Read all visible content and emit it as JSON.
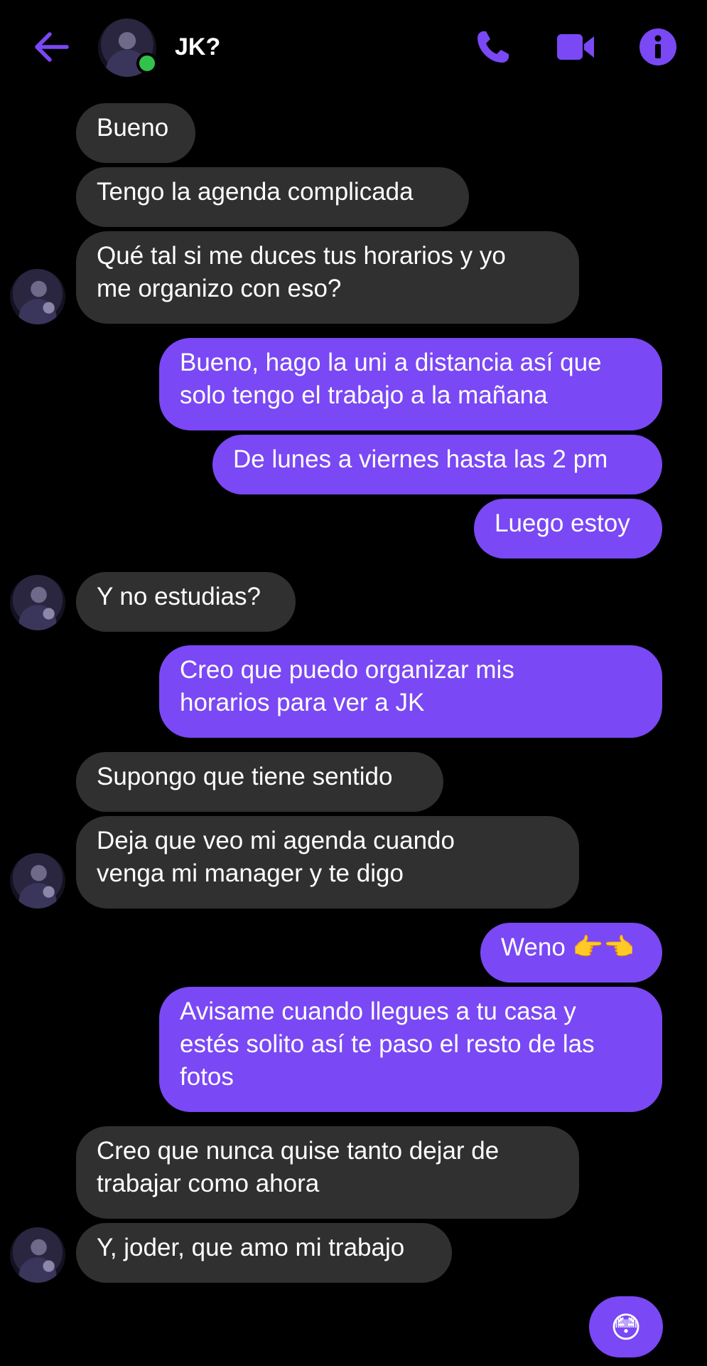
{
  "header": {
    "contact_name": "JK?",
    "status": "online",
    "icons": {
      "back": "back-arrow-icon",
      "call": "phone-icon",
      "video": "video-camera-icon",
      "info": "info-icon"
    },
    "accent_color": "#7a48f4",
    "online_color": "#31c24b"
  },
  "messages": [
    {
      "side": "received",
      "text": "Bueno"
    },
    {
      "side": "received",
      "text": "Tengo la agenda complicada"
    },
    {
      "side": "received",
      "line1": "Qué tal si me duces tus horarios y yo",
      "line2": "me organizo con eso?"
    },
    {
      "side": "sent",
      "line1": "Bueno, hago la uni a distancia así que",
      "line2": "solo tengo el trabajo a la mañana"
    },
    {
      "side": "sent",
      "text": "De lunes a viernes hasta las 2 pm"
    },
    {
      "side": "sent",
      "text": "Luego estoy"
    },
    {
      "side": "received",
      "text": "Y no estudias?"
    },
    {
      "side": "sent",
      "line1": "Creo que puedo organizar mis",
      "line2": "horarios para ver a JK"
    },
    {
      "side": "received",
      "text": "Supongo que tiene sentido"
    },
    {
      "side": "received",
      "line1": "Deja que veo mi agenda cuando",
      "line2": "venga mi manager y te digo"
    },
    {
      "side": "sent",
      "text": "Weno 👉👈"
    },
    {
      "side": "sent",
      "line1": "Avisame cuando llegues a tu casa y",
      "line2": "estés solito así te paso el resto de las",
      "line3": "fotos"
    },
    {
      "side": "received",
      "line1": "Creo que nunca quise tanto dejar de",
      "line2": "trabajar como ahora"
    },
    {
      "side": "received",
      "text": "Y, joder, que amo mi trabajo"
    }
  ],
  "composer": {
    "quick_reaction": "😳"
  },
  "colors": {
    "background": "#000000",
    "received_bubble": "#303030",
    "sent_bubble": "#7a48f4"
  }
}
